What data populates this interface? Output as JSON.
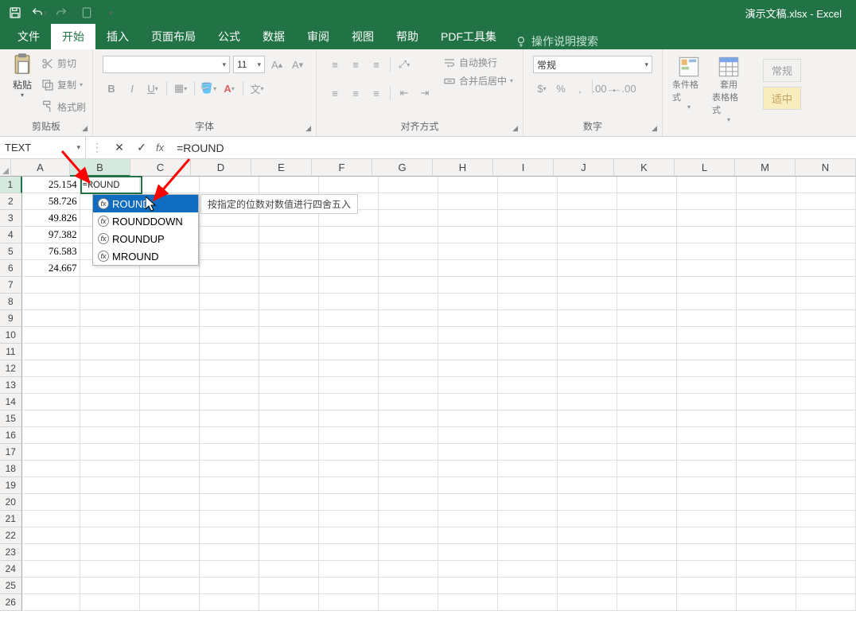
{
  "app": {
    "title_file": "演示文稿.xlsx",
    "title_app": "Excel"
  },
  "qat": {
    "save": "save-icon",
    "undo": "undo-icon",
    "redo": "redo-icon",
    "touch": "touch-icon"
  },
  "tabs": {
    "file": "文件",
    "home": "开始",
    "insert": "插入",
    "layout": "页面布局",
    "formula": "公式",
    "data": "数据",
    "review": "审阅",
    "view": "视图",
    "help": "帮助",
    "pdf": "PDF工具集",
    "tell_me": "操作说明搜索"
  },
  "ribbon": {
    "clipboard": {
      "paste": "粘贴",
      "cut": "剪切",
      "copy": "复制",
      "format_painter": "格式刷",
      "label": "剪贴板"
    },
    "font": {
      "name": "",
      "size": "11",
      "label": "字体"
    },
    "align": {
      "wrap": "自动换行",
      "merge": "合并后居中",
      "label": "对齐方式"
    },
    "number": {
      "format": "常规",
      "label": "数字"
    },
    "styles": {
      "cond": "条件格式",
      "table": "套用",
      "table2": "表格格式",
      "label": ""
    },
    "cells": {
      "general": "常规",
      "neutral": "适中"
    }
  },
  "formula_bar": {
    "name_box": "TEXT",
    "formula": "=ROUND"
  },
  "grid": {
    "columns": [
      "A",
      "B",
      "C",
      "D",
      "E",
      "F",
      "G",
      "H",
      "I",
      "J",
      "K",
      "L",
      "M",
      "N"
    ],
    "col_widths": {
      "A": 74,
      "default": 76
    },
    "rows": [
      1,
      2,
      3,
      4,
      5,
      6,
      7,
      8,
      9,
      10,
      11,
      12,
      13,
      14,
      15,
      16,
      17,
      18,
      19,
      20,
      21,
      22,
      23,
      24,
      25,
      26
    ],
    "data": {
      "A1": "25.154",
      "A2": "58.726",
      "A3": "49.826",
      "A4": "97.382",
      "A5": "76.583",
      "A6": "24.667",
      "B1": "=ROUND"
    },
    "active_cell": "B1"
  },
  "autocomplete": {
    "items": [
      {
        "name": "ROUND",
        "selected": true
      },
      {
        "name": "ROUNDDOWN",
        "selected": false
      },
      {
        "name": "ROUNDUP",
        "selected": false
      },
      {
        "name": "MROUND",
        "selected": false
      }
    ],
    "tooltip": "按指定的位数对数值进行四舍五入"
  },
  "colors": {
    "primary": "#217346",
    "accent_blue": "#0f6cbf",
    "arrow_red": "#ff0000"
  }
}
